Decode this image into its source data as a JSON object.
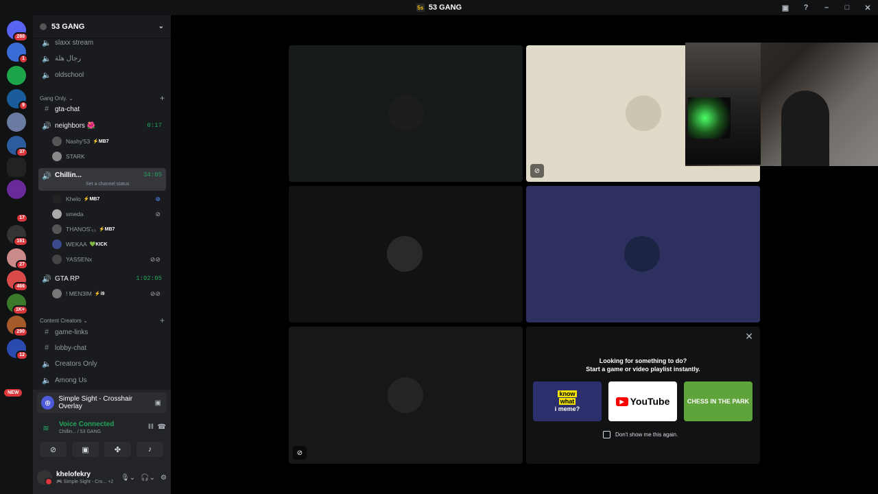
{
  "window": {
    "title": "53 GANG",
    "server_icon": "5s"
  },
  "servers": {
    "badges": [
      "288",
      "1",
      "",
      "9",
      "",
      "37",
      "",
      "",
      "17",
      "161",
      "27",
      "466",
      "1K+",
      "290",
      "12"
    ],
    "new_label": "NEW"
  },
  "guild": {
    "name": "53 GANG"
  },
  "channels": {
    "top": [
      {
        "name": "slaxx stream",
        "icon": "speaker-icon"
      },
      {
        "name": "رجال هلة",
        "icon": "speaker-icon"
      },
      {
        "name": "oldschool",
        "icon": "speaker-icon"
      }
    ],
    "category_gang": "Gang Only.",
    "gta_chat": "gta-chat",
    "neighbors": {
      "name": "neighbors 🌺",
      "timer": "0:17"
    },
    "neighbors_users": [
      {
        "name": "Nashy'53",
        "tag": "⚡MB7"
      },
      {
        "name": "STARK",
        "tag": ""
      }
    ],
    "chillin": {
      "name": "Chillin...",
      "timer": "34:05",
      "status": "Set a channel status"
    },
    "chillin_users": [
      {
        "name": "Khelo",
        "tag": "⚡MB7"
      },
      {
        "name": "smeda",
        "tag": ""
      },
      {
        "name": "THANOS'₅₃",
        "tag": "⚡MB7"
      },
      {
        "name": "WEKAA",
        "tag": "💚KICK"
      },
      {
        "name": "YASSENx",
        "tag": ""
      }
    ],
    "gtarp": {
      "name": "GTA RP",
      "timer": "1:02:05"
    },
    "gtarp_users": [
      {
        "name": "! MEN3IM",
        "tag": "⚡i9"
      }
    ],
    "category_creators": "Content Creators",
    "creators": [
      "game-links",
      "lobby-chat",
      "Creators Only",
      "Among Us"
    ]
  },
  "panel": {
    "activity": "Simple Sight - Crosshair Overlay",
    "voice_status": "Voice Connected",
    "voice_channel": "Chillin... / 53 GANG",
    "username": "khelofekry",
    "user_status": "🎮 Simple Sight - Cro...",
    "user_status_extra": "+2"
  },
  "activity_card": {
    "line1": "Looking for something to do?",
    "line2": "Start a game or video playlist instantly.",
    "opt1_a": "know",
    "opt1_b": "what",
    "opt1_c": "i meme?",
    "opt2": "YouTube",
    "opt3": "CHESS IN THE PARK",
    "dont_show": "Don't show me this again."
  }
}
